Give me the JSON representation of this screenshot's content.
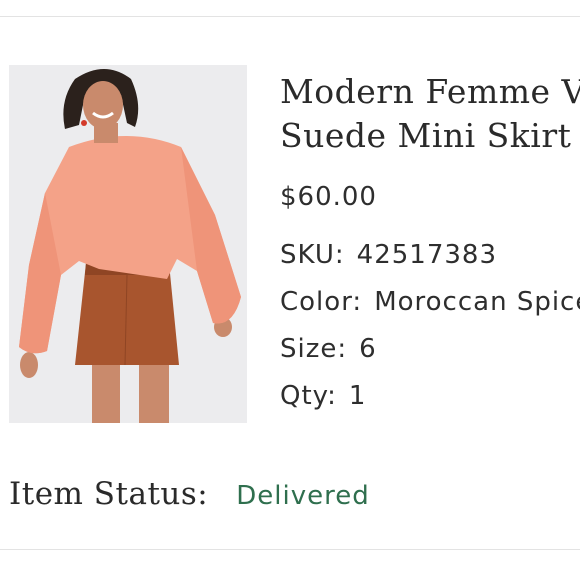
{
  "product": {
    "title_line1": "Modern Femme Vegan",
    "title_line2": "Suede Mini Skirt",
    "price": "$60.00",
    "sku_label": "SKU:",
    "sku_value": "42517383",
    "color_label": "Color:",
    "color_value": "Moroccan Spice",
    "size_label": "Size:",
    "size_value": "6",
    "qty_label": "Qty:",
    "qty_value": "1"
  },
  "status": {
    "label": "Item Status:",
    "value": "Delivered",
    "value_color": "#2f6f4e"
  },
  "photo": {
    "background_color": "#ececee",
    "sweater_color": "#f4a288",
    "skirt_color": "#a8552e"
  }
}
